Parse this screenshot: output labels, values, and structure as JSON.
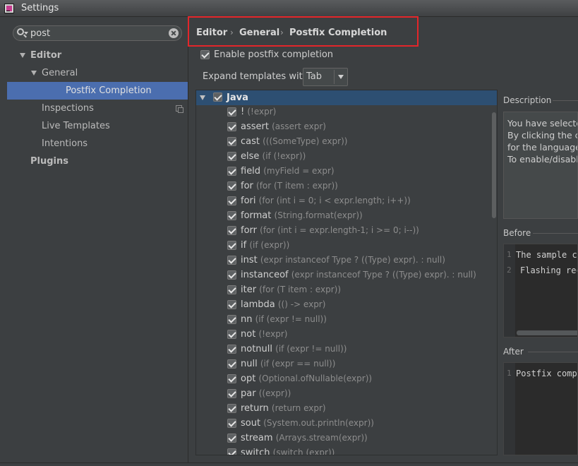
{
  "window": {
    "title": "Settings"
  },
  "search": {
    "value": "post"
  },
  "tree": [
    {
      "label": "Editor",
      "level": 0,
      "expanded": true,
      "bold": true
    },
    {
      "label": "General",
      "level": 1,
      "expanded": true,
      "bold": false
    },
    {
      "label": "Postfix Completion",
      "level": 2,
      "selected": true
    },
    {
      "label": "Inspections",
      "level": 1,
      "copy_icon": true
    },
    {
      "label": "Live Templates",
      "level": 1
    },
    {
      "label": "Intentions",
      "level": 1
    },
    {
      "label": "Plugins",
      "level": 0,
      "bold": true
    }
  ],
  "breadcrumb": {
    "items": [
      "Editor",
      "General",
      "Postfix Completion"
    ],
    "separator": "›"
  },
  "enable": {
    "label": "Enable postfix completion",
    "checked": true
  },
  "expand": {
    "label": "Expand templates with",
    "value": "Tab"
  },
  "templates": {
    "group": "Java",
    "items": [
      {
        "key": "!",
        "example": "(!expr)"
      },
      {
        "key": "assert",
        "example": "(assert expr)"
      },
      {
        "key": "cast",
        "example": "(((SomeType) expr))"
      },
      {
        "key": "else",
        "example": "(if (!expr))"
      },
      {
        "key": "field",
        "example": "(myField = expr)"
      },
      {
        "key": "for",
        "example": "(for (T item : expr))"
      },
      {
        "key": "fori",
        "example": "(for (int i = 0; i < expr.length; i++))"
      },
      {
        "key": "format",
        "example": "(String.format(expr))"
      },
      {
        "key": "forr",
        "example": "(for (int i = expr.length-1; i >= 0; i--))"
      },
      {
        "key": "if",
        "example": "(if (expr))"
      },
      {
        "key": "inst",
        "example": "(expr instanceof Type ? ((Type) expr). : null)"
      },
      {
        "key": "instanceof",
        "example": "(expr instanceof Type ? ((Type) expr). : null)"
      },
      {
        "key": "iter",
        "example": "(for (T item : expr))"
      },
      {
        "key": "lambda",
        "example": "(() -> expr)"
      },
      {
        "key": "nn",
        "example": "(if (expr != null))"
      },
      {
        "key": "not",
        "example": "(!expr)"
      },
      {
        "key": "notnull",
        "example": "(if (expr != null))"
      },
      {
        "key": "null",
        "example": "(if (expr == null))"
      },
      {
        "key": "opt",
        "example": "(Optional.ofNullable(expr))"
      },
      {
        "key": "par",
        "example": "((expr))"
      },
      {
        "key": "return",
        "example": "(return expr)"
      },
      {
        "key": "sout",
        "example": "(System.out.println(expr))"
      },
      {
        "key": "stream",
        "example": "(Arrays.stream(expr))"
      },
      {
        "key": "switch",
        "example": "(switch (expr))"
      }
    ]
  },
  "description": {
    "title": "Description",
    "lines": [
      "You have selected",
      "By clicking the ch",
      "for the language.",
      "To enable/disable"
    ]
  },
  "before": {
    "title": "Before",
    "lines": [
      {
        "num": "1",
        "text": "The sample co"
      },
      {
        "num": "2",
        "text": "Flashing rec"
      }
    ]
  },
  "after": {
    "title": "After",
    "lines": [
      {
        "num": "1",
        "text": "Postfix compl"
      }
    ]
  }
}
